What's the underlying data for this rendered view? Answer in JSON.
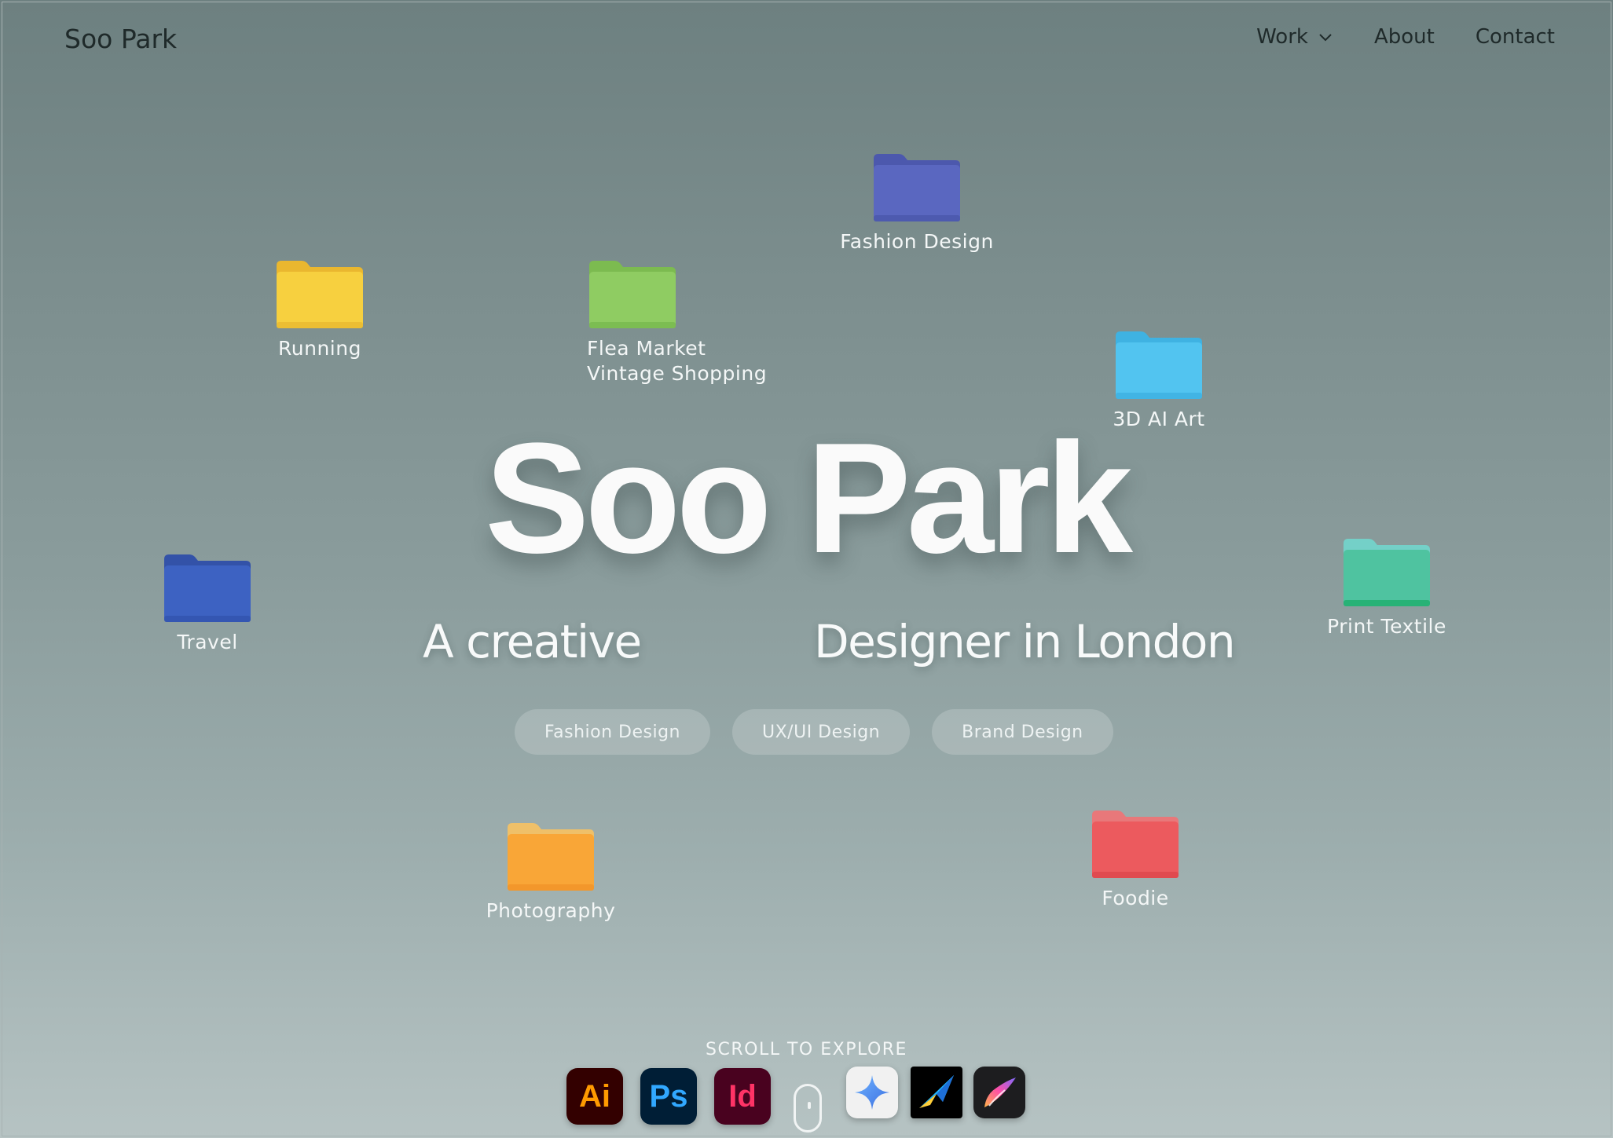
{
  "nav": {
    "brand": "Soo Park",
    "items": [
      {
        "label": "Work",
        "has_dropdown": true,
        "icon": "chevron-down-icon"
      },
      {
        "label": "About"
      },
      {
        "label": "Contact"
      }
    ]
  },
  "folders": [
    {
      "label": "Fashion Design",
      "color": "#5a67c0"
    },
    {
      "label": "Running",
      "color": "#f7d03f"
    },
    {
      "label_lines": [
        "Flea Market",
        "Vintage Shopping"
      ],
      "color": "#8fcc62"
    },
    {
      "label": "3D AI Art",
      "color": "#52c4f0"
    },
    {
      "label": "Travel",
      "color": "#3d62c2"
    },
    {
      "label": "Print Textile",
      "color": "#4fc3a0"
    },
    {
      "label": "Photography",
      "color": "#f9a637"
    },
    {
      "label": "Foodie",
      "color": "#ec5a5e"
    }
  ],
  "hero": {
    "title": "Soo Park",
    "subtitle_left": "A creative",
    "subtitle_right": "Designer in London"
  },
  "tags": [
    "Fashion Design",
    "UX/UI Design",
    "Brand Design"
  ],
  "scroll_hint": "SCROLL TO EXPLORE",
  "tools": [
    {
      "label": "Ai",
      "icon": "adobe-illustrator-icon",
      "bg": "#330000",
      "fg": "#ff9a00"
    },
    {
      "label": "Ps",
      "icon": "adobe-photoshop-icon",
      "bg": "#001e36",
      "fg": "#31a8ff"
    },
    {
      "label": "Id",
      "icon": "adobe-indesign-icon",
      "bg": "#49021f",
      "fg": "#ff3366"
    },
    {
      "icon": "mouse-scroll-icon"
    },
    {
      "icon": "gemini-sparkle-icon",
      "bg": "#f1f1f1"
    },
    {
      "icon": "spline-arrow-icon",
      "bg": "#000000"
    },
    {
      "icon": "procreate-brush-icon",
      "bg": "#1d1d1f"
    }
  ]
}
